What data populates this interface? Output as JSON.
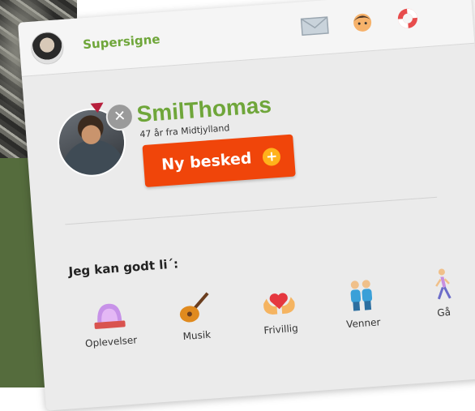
{
  "topbar": {
    "username": "Supersigne",
    "icons": [
      "mail-icon",
      "user-face-icon",
      "help-lifebuoy-icon"
    ]
  },
  "profile": {
    "name": "SmilThomas",
    "subtitle": "47 år fra Midtjylland",
    "message_button": "Ny besked"
  },
  "likes": {
    "label": "Jeg kan godt li´:",
    "items": [
      {
        "label": "Oplevelser",
        "icon": "disco-light-icon"
      },
      {
        "label": "Musik",
        "icon": "guitar-icon"
      },
      {
        "label": "Frivillig",
        "icon": "heart-hands-icon"
      },
      {
        "label": "Venner",
        "icon": "friends-icon"
      },
      {
        "label": "Gå",
        "icon": "walking-person-icon"
      }
    ]
  },
  "colors": {
    "accent_green": "#6fa63a",
    "button_orange": "#f0450a",
    "plus_yellow": "#ffb21b"
  }
}
